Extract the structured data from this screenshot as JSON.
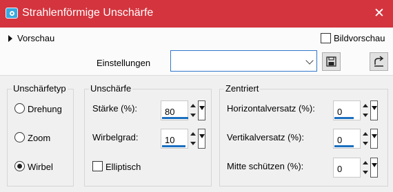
{
  "window": {
    "title": "Strahlenförmige Unschärfe",
    "close_glyph": "✕",
    "accent_color": "#d4343e"
  },
  "toolbar": {
    "preview_label": "Vorschau",
    "image_preview_label": "Bildvorschau",
    "image_preview_checked": false,
    "settings_label": "Einstellungen",
    "settings_value": "",
    "save_icon": "save-icon",
    "reset_icon": "reset-icon"
  },
  "blur_type": {
    "title": "Unschärfetyp",
    "options": [
      {
        "label": "Drehung",
        "selected": false
      },
      {
        "label": "Zoom",
        "selected": false
      },
      {
        "label": "Wirbel",
        "selected": true
      }
    ]
  },
  "blur": {
    "title": "Unschärfe",
    "strength_label": "Stärke (%):",
    "strength_value": "80",
    "swirl_label": "Wirbelgrad:",
    "swirl_value": "10",
    "elliptical_label": "Elliptisch",
    "elliptical_checked": false
  },
  "center": {
    "title": "Zentriert",
    "h_offset_label": "Horizontalversatz (%):",
    "h_offset_value": "0",
    "v_offset_label": "Vertikalversatz (%):",
    "v_offset_value": "0",
    "protect_center_label": "Mitte schützen (%):",
    "protect_center_value": "0"
  }
}
